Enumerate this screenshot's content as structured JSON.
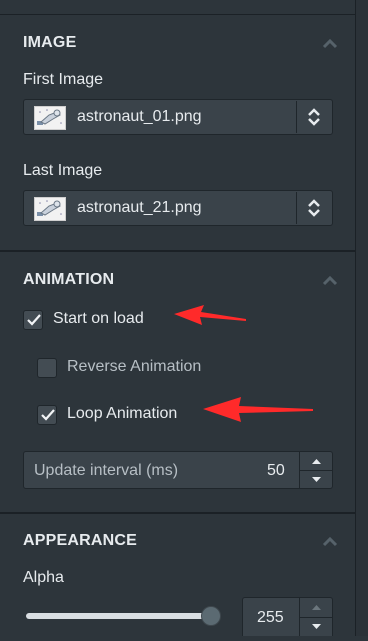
{
  "image_section": {
    "title": "IMAGE",
    "first_image_label": "First Image",
    "first_image_value": "astronaut_01.png",
    "last_image_label": "Last Image",
    "last_image_value": "astronaut_21.png"
  },
  "animation_section": {
    "title": "ANIMATION",
    "start_on_load": {
      "label": "Start on load",
      "checked": true
    },
    "reverse_animation": {
      "label": "Reverse Animation",
      "checked": false
    },
    "loop_animation": {
      "label": "Loop Animation",
      "checked": true
    },
    "update_interval": {
      "label": "Update interval (ms)",
      "value": "50"
    }
  },
  "appearance_section": {
    "title": "APPEARANCE",
    "alpha_label": "Alpha",
    "alpha_value": "255",
    "alpha_slider_fraction": 1.0
  },
  "colors": {
    "panel_bg": "#2d353b",
    "annotation_arrow": "#ff2a2a"
  },
  "icons": {
    "collapse": "chevron-up-icon",
    "select_spinner": "up-down-arrows-icon",
    "checkbox": "checkmark-icon",
    "annotation": "red-arrow-icon"
  }
}
